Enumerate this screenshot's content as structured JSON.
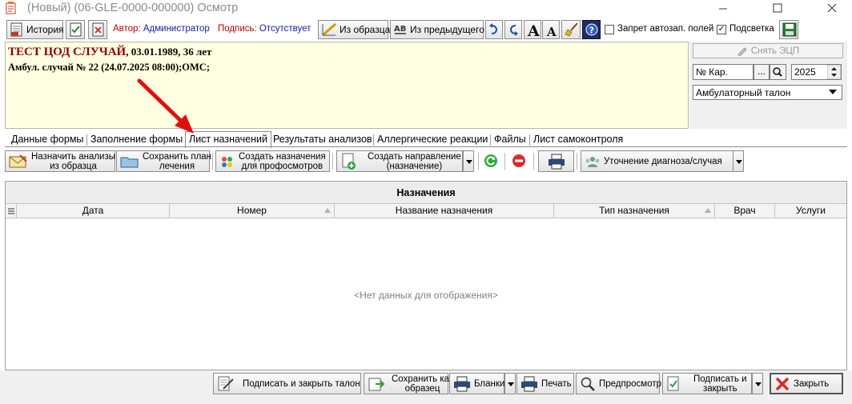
{
  "window": {
    "title": "(Новый) (06-GLE-0000-000000) Осмотр"
  },
  "toolbar": {
    "history_label": "История",
    "author_label": "Автор:",
    "author_value": "Администратор",
    "signature_label": "Подпись:",
    "signature_value": "Отсутствует",
    "from_template_label": "Из образца",
    "from_previous_label": "Из предыдущего",
    "disable_autofill_label": "Запрет автозап. полей",
    "disable_autofill_checked": false,
    "highlight_label": "Подсветка",
    "highlight_checked": true
  },
  "patient": {
    "name": "ТЕСТ ЦОД СЛУЧАЙ",
    "dob_age": ", 03.01.1989, 36 лет",
    "case_line": "Амбул. случай  № 22 (24.07.2025 08:00);ОМС;"
  },
  "right_panel": {
    "remove_signature_label": "Снять ЭЦП",
    "card_field_value": "№ Кар.",
    "card_dots": "...",
    "year_value": "2025",
    "doc_type_value": "Амбулаторный талон"
  },
  "tabs": [
    {
      "label": "Данные формы"
    },
    {
      "label": "Заполнение формы"
    },
    {
      "label": "Лист назначений"
    },
    {
      "label": "Результаты анализов"
    },
    {
      "label": "Аллергические реакции"
    },
    {
      "label": "Файлы"
    },
    {
      "label": "Лист самоконтроля"
    }
  ],
  "actions": {
    "assign_tests_l1": "Назначить анализы",
    "assign_tests_l2": "из образца",
    "save_plan_l1": "Сохранить план",
    "save_plan_l2": "лечения",
    "create_prof_l1": "Создать назначения",
    "create_prof_l2": "для профосмотров",
    "create_referral_l1": "Создать направление",
    "create_referral_l2": "(назначение)",
    "refine_diagnosis_label": "Уточнение диагноза/случая"
  },
  "grid": {
    "caption": "Назначения",
    "columns": [
      "Дата",
      "Номер",
      "Название назначения",
      "Тип назначения",
      "Врач",
      "Услуги"
    ],
    "empty_text": "<Нет данных для отображения>"
  },
  "bottom": {
    "sign_close_label": "Подписать и закрыть талон",
    "save_template_l1": "Сохранить как",
    "save_template_l2": "образец",
    "forms_label": "Бланки",
    "print_label": "Печать",
    "preview_label": "Предпросмотр",
    "sign_and_close_l1": "Подписать и",
    "sign_and_close_l2": "закрыть",
    "close_label": "Закрыть"
  },
  "colors": {
    "info_bg": "#ffffe1",
    "patient_name": "#8b0000",
    "author_key": "#b00000",
    "author_value": "#1a1aa0",
    "arrow": "#e01010"
  }
}
